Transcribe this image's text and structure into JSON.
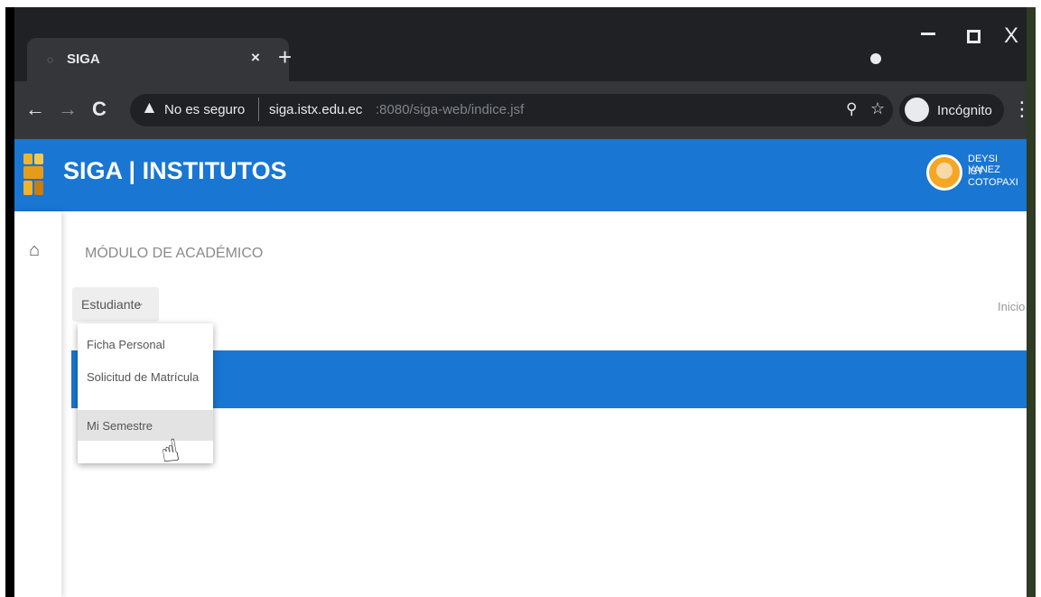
{
  "browser": {
    "tab_title": "SIGA",
    "tab_close": "×",
    "new_tab": "+",
    "window_controls": {
      "minimize": "–",
      "close": "X"
    },
    "nav": {
      "back": "←",
      "forward": "→",
      "reload": "C"
    },
    "security_label": "No es seguro",
    "url_host": "siga.istx.edu.ec",
    "url_rest": ":8080/siga-web/indice.jsf",
    "incognito_label": "Incógnito",
    "icons": [
      "globe-icon",
      "warning-icon",
      "search-icon",
      "star-icon",
      "incognito-icon",
      "menu-dots-icon"
    ]
  },
  "app": {
    "brand": "SIGA | INSTITUTOS",
    "header_color": "#1976d2",
    "user": {
      "name": "DEYSI YANEZ",
      "institute": "IST COTOPAXI"
    }
  },
  "main": {
    "module_title": "MÓDULO DE ACADÉMICO",
    "menu_label": "Estudiante",
    "breadcrumb": "Inicio",
    "menu_items": [
      "Ficha Personal",
      "Solicitud de Matrícula",
      "Mi Semestre"
    ],
    "active_item": "Mi Semestre"
  }
}
